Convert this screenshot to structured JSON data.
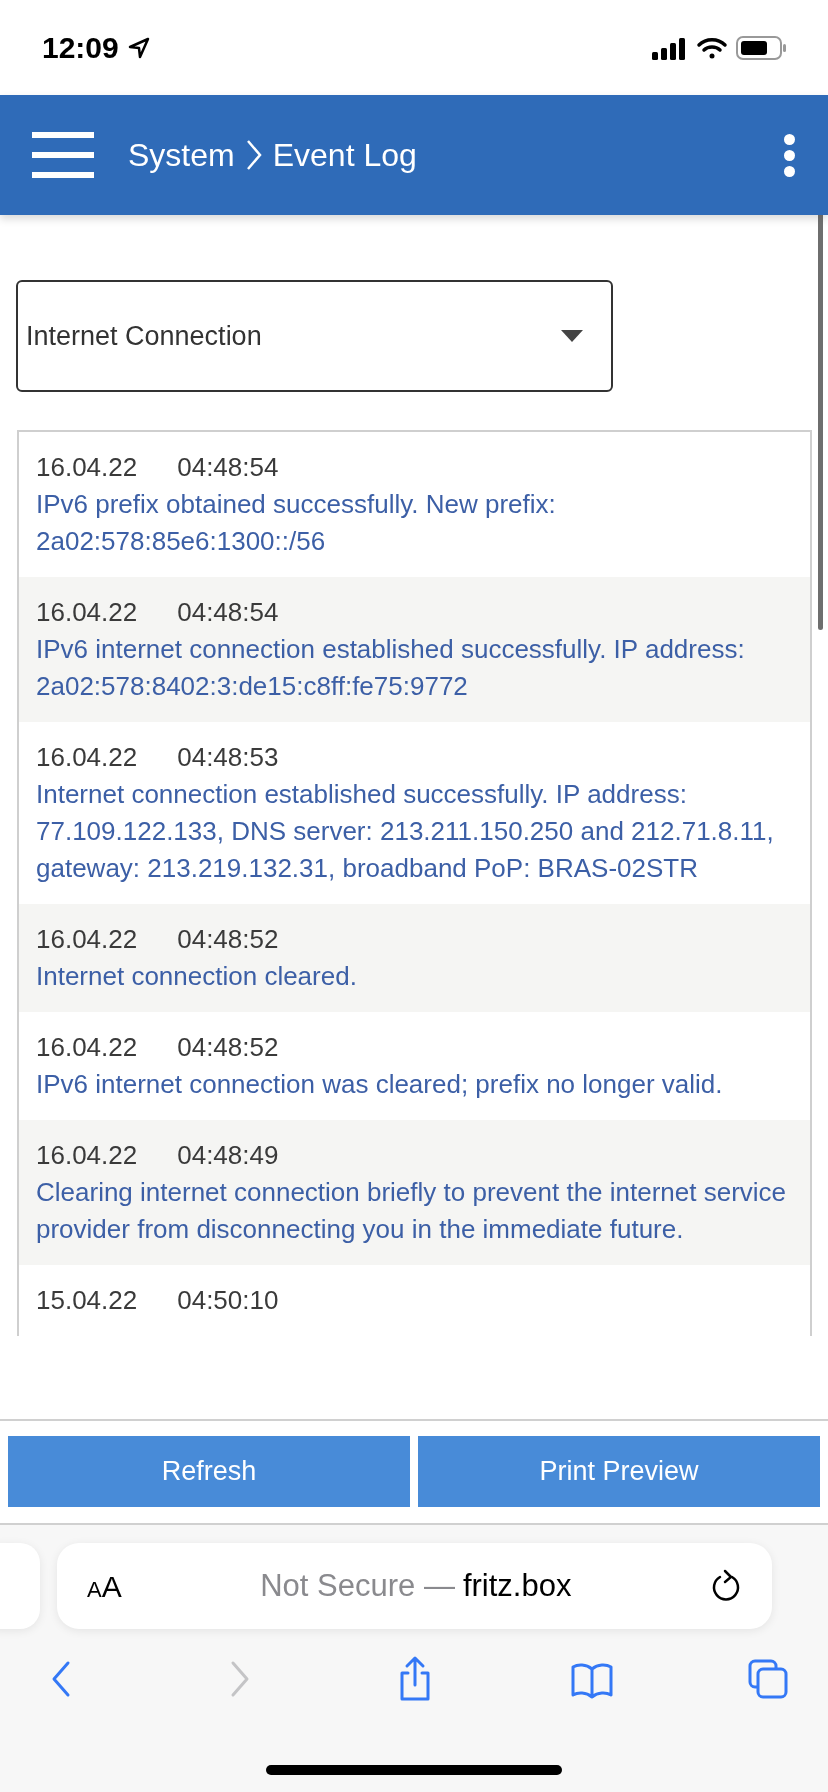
{
  "status_bar": {
    "time": "12:09"
  },
  "header": {
    "breadcrumb": [
      "System",
      "Event Log"
    ]
  },
  "filter": {
    "value": "Internet Connection"
  },
  "entries": [
    {
      "date": "16.04.22",
      "time": "04:48:54",
      "message": "IPv6 prefix obtained successfully. New prefix: 2a02:578:85e6:1300::/56"
    },
    {
      "date": "16.04.22",
      "time": "04:48:54",
      "message": "IPv6 internet connection established successfully. IP address: 2a02:578:8402:3:de15:c8ff:fe75:9772"
    },
    {
      "date": "16.04.22",
      "time": "04:48:53",
      "message": "Internet connection established successfully. IP address: 77.109.122.133, DNS server: 213.211.150.250 and 212.71.8.11, gateway: 213.219.132.31, broadband PoP: BRAS-02STR"
    },
    {
      "date": "16.04.22",
      "time": "04:48:52",
      "message": "Internet connection cleared."
    },
    {
      "date": "16.04.22",
      "time": "04:48:52",
      "message": "IPv6 internet connection was cleared; prefix no longer valid."
    },
    {
      "date": "16.04.22",
      "time": "04:48:49",
      "message": "Clearing internet connection briefly to prevent the internet service provider from disconnecting you in the immediate future."
    },
    {
      "date": "15.04.22",
      "time": "04:50:10"
    }
  ],
  "buttons": [
    "Refresh",
    "Print Preview"
  ],
  "browser": {
    "text_size": "AA",
    "security": "Not Secure —",
    "host": "fritz.box",
    "toolbar": [
      {
        "kind": "back",
        "disabled": false
      },
      {
        "kind": "forward",
        "disabled": true
      },
      {
        "kind": "share",
        "disabled": false
      },
      {
        "kind": "bookmarks",
        "disabled": false
      },
      {
        "kind": "tabs",
        "disabled": false
      }
    ]
  }
}
